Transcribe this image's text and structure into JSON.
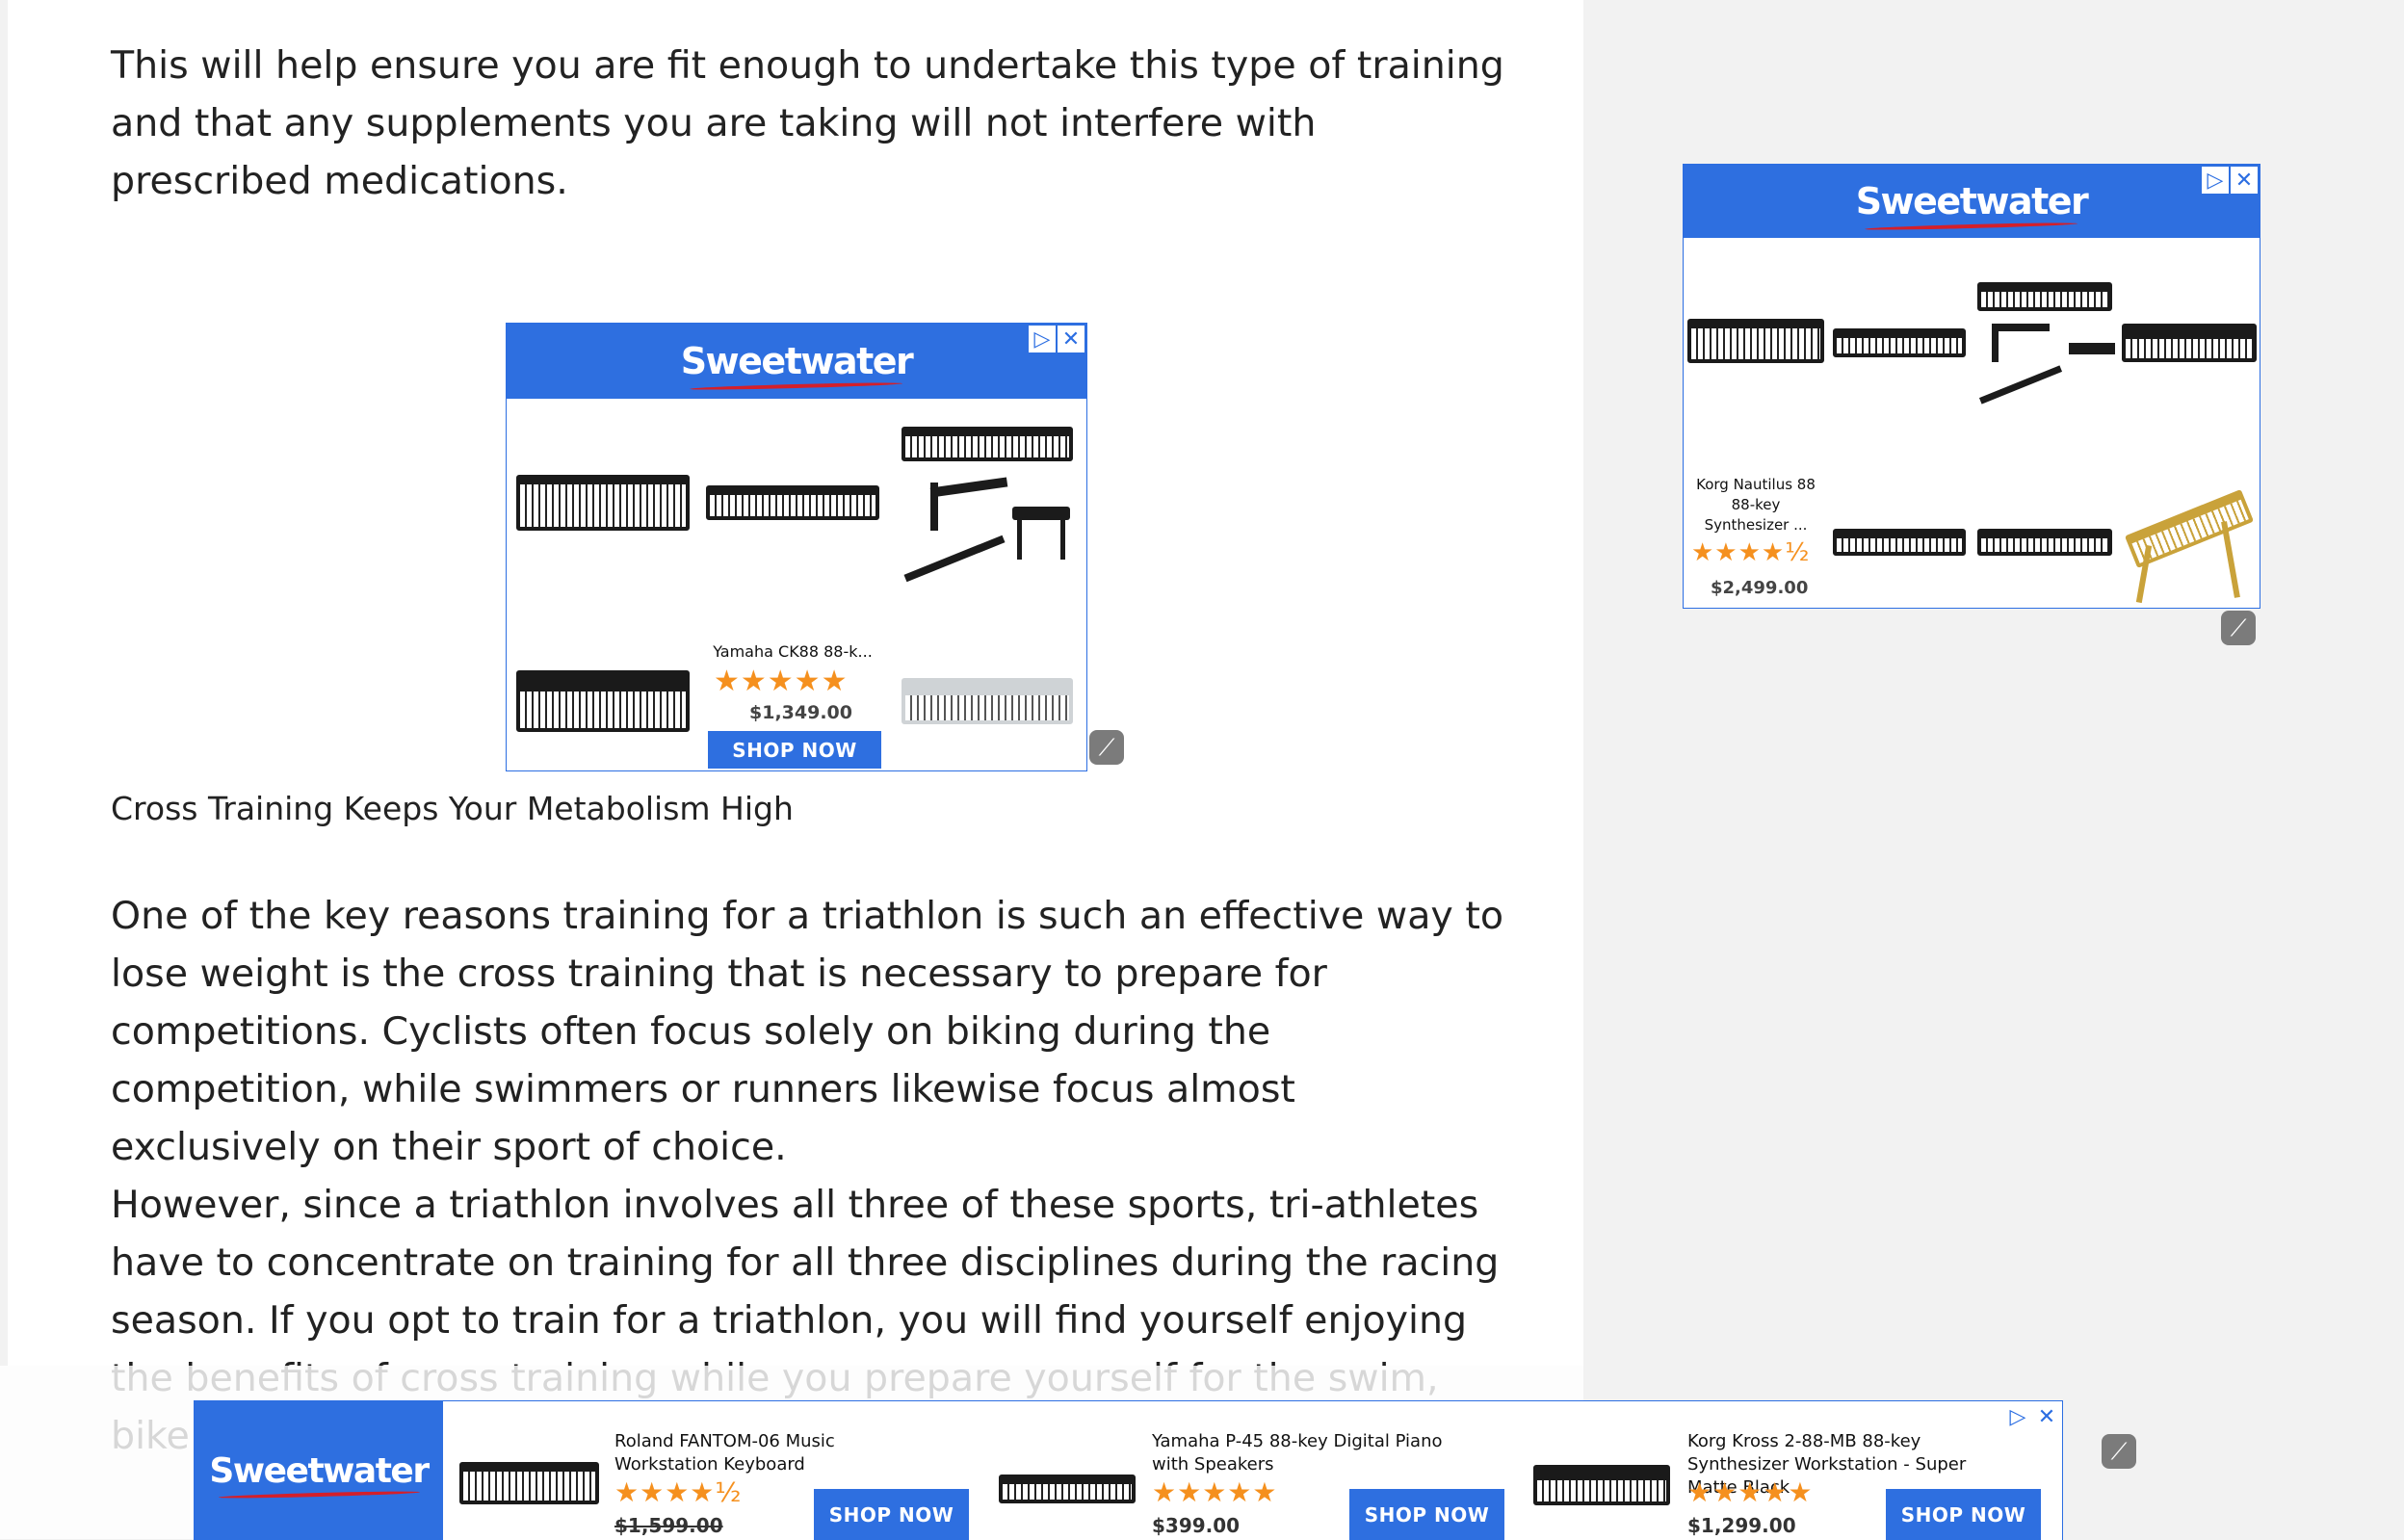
{
  "article": {
    "para1": "This will help ensure you are fit enough to undertake this type of training and that any supplements you are taking will not interfere with prescribed medications.",
    "caption": "Cross Training Keeps Your Metabolism High",
    "para2": "One of the key reasons training for a triathlon is such an effective way to lose weight is the cross training that is necessary to prepare for competitions. Cyclists often focus solely on biking during the competition, while swimmers or runners likewise focus almost exclusively on their sport of choice.",
    "para3": "However, since a triathlon involves all three of these sports, tri-athletes have to concentrate on training for all three disciplines during the racing season. If you opt to train for a triathlon, you will find yourself enjoying the benefits of cross training while you prepare yourself for the swim, bike and run portions of the"
  },
  "inline_ad": {
    "brand": "Sweetwater",
    "product_name": "Yamaha CK88 88-k...",
    "rating": "★★★★★",
    "price": "$1,349.00",
    "cta": "SHOP NOW"
  },
  "sidebar_ad": {
    "brand": "Sweetwater",
    "product_name": "Korg Nautilus 88 88-key Synthesizer ...",
    "rating": "★★★★½",
    "price": "$2,499.00"
  },
  "bottom_ad": {
    "brand": "Sweetwater",
    "products": [
      {
        "name": "Roland FANTOM-06 Music Workstation Keyboard",
        "rating": "★★★★½",
        "price": "$1,599.00",
        "cta": "SHOP NOW"
      },
      {
        "name": "Yamaha P-45 88-key Digital Piano with Speakers",
        "rating": "★★★★★",
        "price": "$399.00",
        "cta": "SHOP NOW"
      },
      {
        "name": "Korg Kross 2-88-MB 88-key Synthesizer Workstation - Super Matte Black",
        "rating": "★★★★★",
        "price": "$1,299.00",
        "cta": "SHOP NOW"
      }
    ]
  },
  "colors": {
    "ad_blue": "#2e6fe0",
    "star_orange": "#f5901e",
    "text": "#222222"
  },
  "icons": [
    "adchoices-icon",
    "close-icon",
    "leaf-icon",
    "keyboard-image"
  ]
}
